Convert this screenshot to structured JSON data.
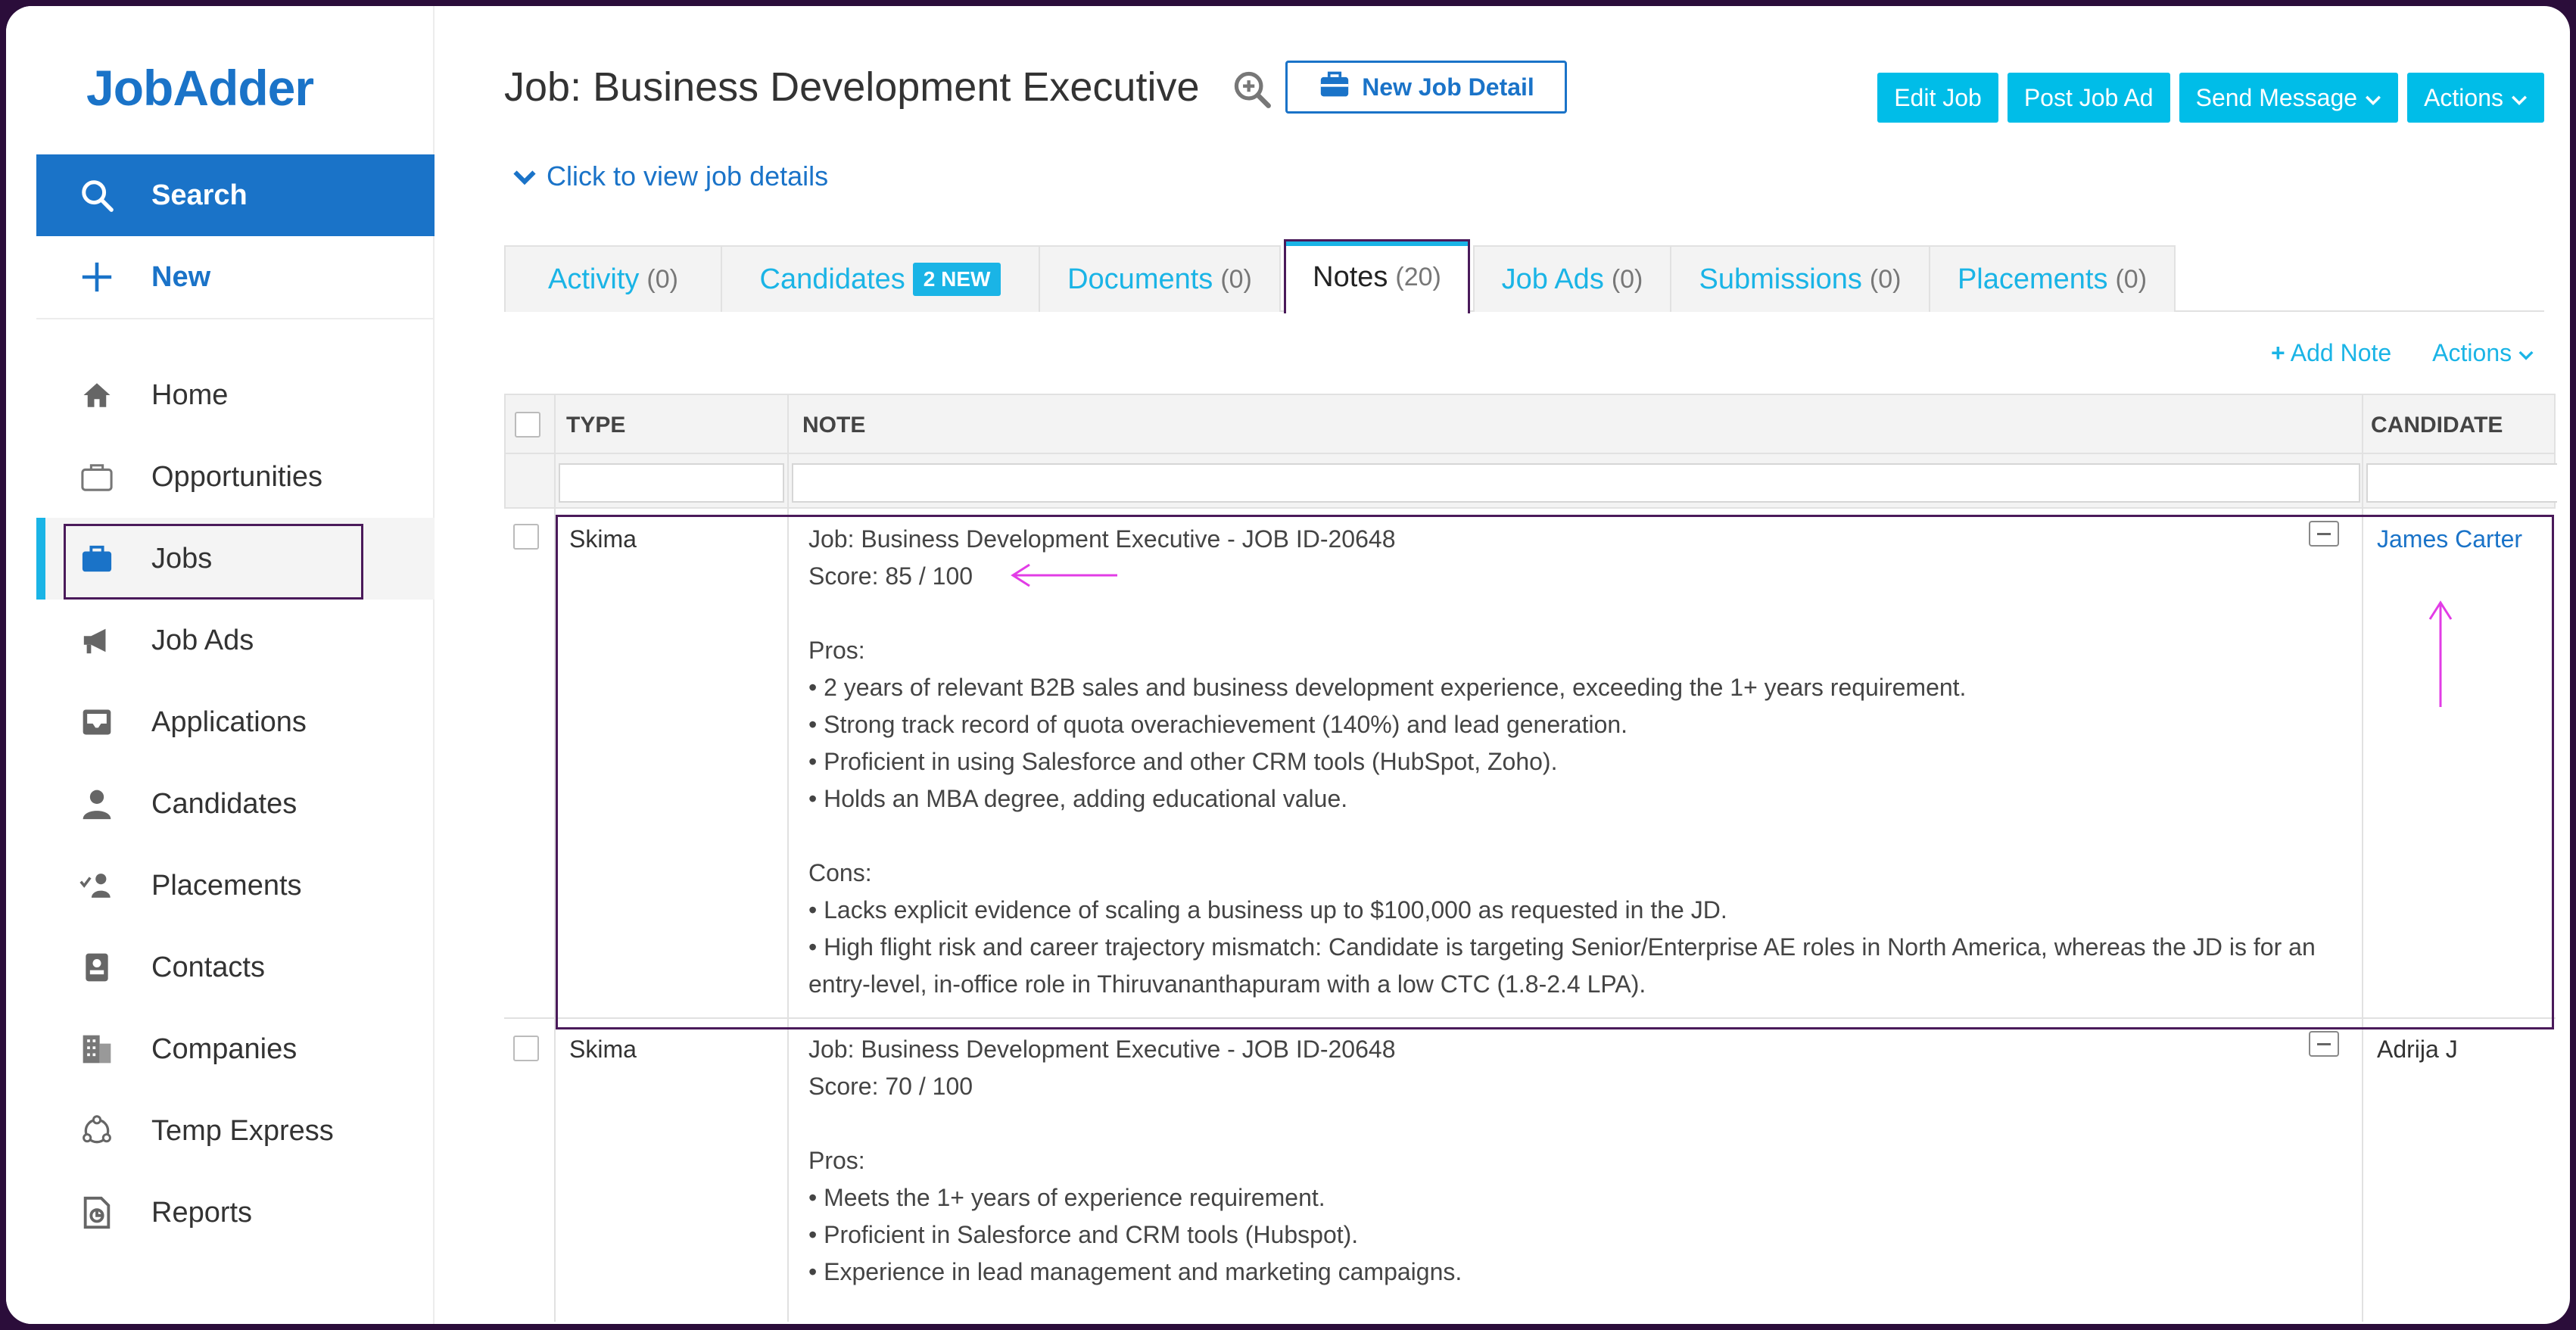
{
  "brand": {
    "logo_text": "JobAdder",
    "accent": "#1a73c8",
    "cyan": "#00bde8"
  },
  "sidebar": {
    "search_label": "Search",
    "new_label": "New",
    "items": [
      {
        "label": "Home",
        "icon": "home-icon"
      },
      {
        "label": "Opportunities",
        "icon": "briefcase-outline-icon"
      },
      {
        "label": "Jobs",
        "icon": "briefcase-icon",
        "active": true
      },
      {
        "label": "Job Ads",
        "icon": "megaphone-icon"
      },
      {
        "label": "Applications",
        "icon": "inbox-icon"
      },
      {
        "label": "Candidates",
        "icon": "person-icon"
      },
      {
        "label": "Placements",
        "icon": "person-check-icon"
      },
      {
        "label": "Contacts",
        "icon": "contact-card-icon"
      },
      {
        "label": "Companies",
        "icon": "building-icon"
      },
      {
        "label": "Temp Express",
        "icon": "temp-express-icon"
      },
      {
        "label": "Reports",
        "icon": "report-icon"
      }
    ]
  },
  "header": {
    "title": "Job: Business Development Executive",
    "new_job_detail_label": "New Job Detail",
    "view_details_label": "Click to view job details",
    "buttons": {
      "edit_job": "Edit Job",
      "post_job_ad": "Post Job Ad",
      "send_message": "Send Message",
      "actions": "Actions"
    }
  },
  "tabs": [
    {
      "label": "Activity",
      "count": "(0)"
    },
    {
      "label": "Candidates",
      "badge": "2 NEW"
    },
    {
      "label": "Documents",
      "count": "(0)"
    },
    {
      "label": "Notes",
      "count": "(20)",
      "active": true
    },
    {
      "label": "Job Ads",
      "count": "(0)"
    },
    {
      "label": "Submissions",
      "count": "(0)"
    },
    {
      "label": "Placements",
      "count": "(0)"
    }
  ],
  "sub_actions": {
    "add_note": "Add Note",
    "actions": "Actions"
  },
  "table": {
    "headers": {
      "type": "TYPE",
      "note": "NOTE",
      "candidate": "CANDIDATE"
    },
    "rows": [
      {
        "type": "Skima",
        "candidate": "James Carter",
        "lines": [
          "Job: Business Development Executive - JOB ID-20648",
          "Score: 85 / 100",
          "",
          "Pros:",
          "• 2 years of relevant B2B sales and business development experience, exceeding the 1+ years requirement.",
          "• Strong track record of quota overachievement (140%) and lead generation.",
          "• Proficient in using Salesforce and other CRM tools (HubSpot, Zoho).",
          "• Holds an MBA degree, adding educational value.",
          "",
          "Cons:",
          "• Lacks explicit evidence of scaling a business up to $100,000 as requested in the JD.",
          "• High flight risk and career trajectory mismatch: Candidate is targeting Senior/Enterprise AE roles in North America, whereas the JD is for an",
          "entry-level, in-office role in Thiruvananthapuram with a low CTC (1.8-2.4 LPA)."
        ]
      },
      {
        "type": "Skima",
        "candidate": "Adrija J",
        "lines": [
          "Job: Business Development Executive - JOB ID-20648",
          "Score: 70 / 100",
          "",
          "Pros:",
          "• Meets the 1+ years of experience requirement.",
          "• Proficient in Salesforce and CRM tools (Hubspot).",
          "• Experience in lead management and marketing campaigns."
        ]
      }
    ]
  }
}
